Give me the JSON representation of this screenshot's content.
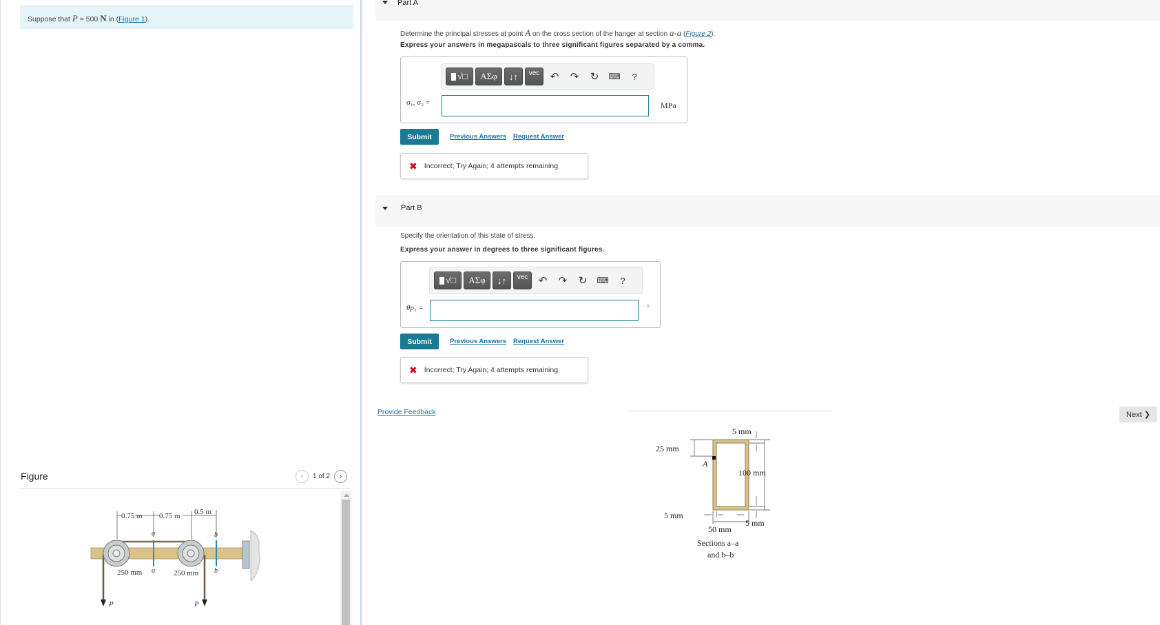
{
  "intro": {
    "prefix": "Suppose that",
    "variable": "P",
    "equals": "= 500",
    "unit": "N",
    "mid": "in (",
    "figure_link": "Figure 1",
    "suffix": ")."
  },
  "figure_panel": {
    "title": "Figure",
    "pager": "1 of 2",
    "prev_icon": "chevron-left",
    "next_icon": "chevron-right",
    "figure1": {
      "dims": [
        "0.75 m",
        "0.75 m",
        "0.5 m"
      ],
      "pulley_radius_1": "250 mm",
      "pulley_radius_2": "250 mm",
      "section_a": "a",
      "section_b": "b",
      "load_label": "P"
    }
  },
  "part_a": {
    "header": "Part A",
    "question_pre": "Determine the principal stresses at point",
    "point": "A",
    "question_mid": "on the cross section of the hanger at section",
    "section": "a-a",
    "figure_link": "Figure 2",
    "instruction": "Express your answers in megapascals to three significant figures separated by a comma.",
    "toolbar": {
      "templates_label": "√□",
      "greek_label": "ΑΣφ",
      "arrows_label": "↓↑",
      "vec_label": "vec",
      "undo_icon": "undo",
      "redo_icon": "redo",
      "reset_icon": "reset",
      "keyboard_icon": "keyboard",
      "help_label": "?"
    },
    "variable_label": "σ₁, σ₂ =",
    "input_value": "",
    "unit": "MPa",
    "submit_label": "Submit",
    "previous_answers": "Previous Answers",
    "request_answer": "Request Answer",
    "feedback": "Incorrect; Try Again; 4 attempts remaining"
  },
  "part_b": {
    "header": "Part B",
    "question": "Specify the orientation of this state of stress.",
    "instruction": "Express your answer in degrees to three significant figures.",
    "toolbar": {
      "templates_label": "√□",
      "greek_label": "ΑΣφ",
      "arrows_label": "↓↑",
      "vec_label": "vec",
      "undo_icon": "undo",
      "redo_icon": "redo",
      "reset_icon": "reset",
      "keyboard_icon": "keyboard",
      "help_label": "?"
    },
    "variable_label": "θp₁ =",
    "input_value": "",
    "unit": "°",
    "submit_label": "Submit",
    "previous_answers": "Previous Answers",
    "request_answer": "Request Answer",
    "feedback": "Incorrect; Try Again; 4 attempts remaining"
  },
  "provide_feedback": "Provide Feedback",
  "next_label": "Next ❯",
  "figure2": {
    "top_wall": "5 mm",
    "point_offset": "25 mm",
    "point_label": "A",
    "height": "100 mm",
    "left_wall": "5 mm",
    "bottom_wall": "5 mm",
    "width": "50 mm",
    "caption_line1": "Sections a–a",
    "caption_line2": "and b–b"
  },
  "colors": {
    "accent": "#1a7a94",
    "link": "#1a73a7",
    "error": "#d0021b",
    "intro_bg": "#e5f4f6",
    "header_bg": "#f7f7f7"
  }
}
